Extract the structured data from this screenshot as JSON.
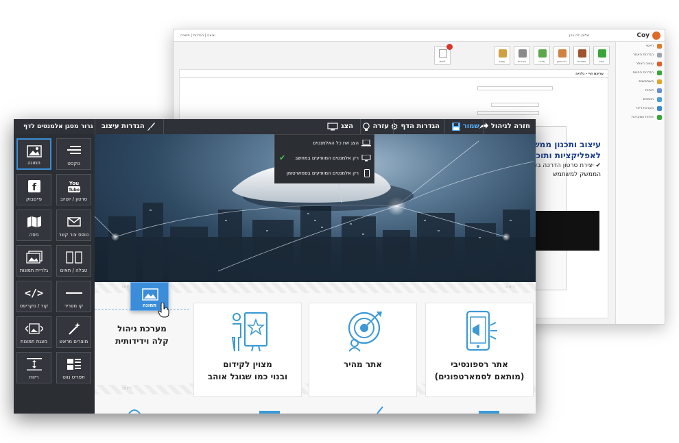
{
  "back": {
    "logo": "Coy",
    "user": "שלום, דני כהן",
    "links": "יציאה | הגדרות | תמיכה",
    "side": [
      {
        "label": "ראשי",
        "color": "#e07a2a"
      },
      {
        "label": "הגדרות האתר",
        "color": "#9aa4b0"
      },
      {
        "label": "עיצוב האתר",
        "color": "#e35d2a"
      },
      {
        "label": "הגדרות החנות",
        "color": "#3aa63a"
      },
      {
        "label": "משתמשים",
        "color": "#e0a52a"
      },
      {
        "label": "דוחות",
        "color": "#6a8fd0"
      },
      {
        "label": "תוספים",
        "color": "#4aa0d0"
      },
      {
        "label": "מערכת דיוור",
        "color": "#3a8ad0"
      },
      {
        "label": "אודות המערכת",
        "color": "#3aa63a"
      }
    ],
    "tools": [
      {
        "label": "אתר",
        "color": "#3aa63a"
      },
      {
        "label": "מוצרים",
        "color": "#a0522d"
      },
      {
        "label": "דפי תוכן",
        "color": "#d08040"
      },
      {
        "label": "גלריה",
        "color": "#5aa84a"
      },
      {
        "label": "הגדרות",
        "color": "#8a8a8a"
      },
      {
        "label": "עיצוב",
        "color": "#d0a040"
      }
    ],
    "tool_left": "לידים",
    "page_title": "עריכת דף - גלריה",
    "editor_line1": "עיצוב ותכנון ממשק",
    "editor_line2": "לאפליקציות ותוכנו",
    "editor_line3": "✔ יצירת סרטון הדרכה באנימ",
    "editor_line4": "הממשק למשתמש"
  },
  "topbar": {
    "back_label": "חזרה לניהול",
    "save_label": "שמור",
    "page_settings_label": "הגדרות הדף",
    "help_label": "עזרה",
    "view_label": "הצג",
    "design_settings_label": "הגדרות עיצוב",
    "drag_title": "גרור מסגן אלמנטים לדף"
  },
  "view_menu": {
    "items": [
      "הצג את כל האלמנטים",
      "רק אלמנטים המופיעים במחשב",
      "רק אלמנטים המופיעים בסמארטפון"
    ]
  },
  "tools": {
    "text": "טקסט",
    "image": "תמונה",
    "video": "סרטון / יוטיוב",
    "facebook": "פייסבוק",
    "contact": "טופס צור קשר",
    "map": "מפה",
    "table": "טבלה / תאים",
    "gallery": "גלריית תמונות",
    "separator": "קו מפריד",
    "code": "קוד / סקריפט",
    "products": "מוצרים מראש",
    "slideshow": "מצגת תמונות",
    "spacing": "ריווח",
    "news": "תפריט נווט"
  },
  "drag_ghost": "תמונה",
  "stripe_word": "ריווח",
  "cards": [
    {
      "title1": "אתר רספונסיבי",
      "title2": "(מותאם לסמארטפונים)"
    },
    {
      "title1": "אתר מהיר",
      "title2": ""
    },
    {
      "title1": "מצוין לקידום",
      "title2": "ובנוי כמו שגוגל אוהב"
    },
    {
      "title1": "מערכת ניהול",
      "title2": "קלה וידידותית"
    }
  ],
  "colors": {
    "accent": "#3b8dd9",
    "panel": "#2b2e33",
    "save": "#5ab0ff"
  }
}
